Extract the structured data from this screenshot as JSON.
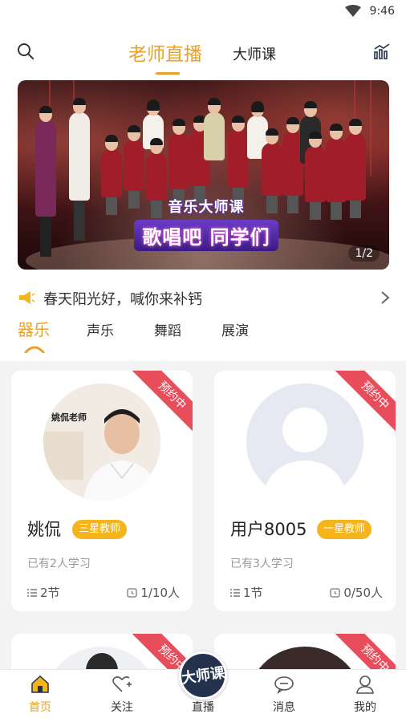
{
  "status_bar": {
    "time": "9:46"
  },
  "header": {
    "tab_live": "老师直播",
    "tab_master": "大师课"
  },
  "banner": {
    "title_line1": "音乐大师课",
    "title_line2": "歌唱吧 同学们",
    "pager": "1/2"
  },
  "notice": {
    "text": "春天阳光好，喊你来补钙"
  },
  "categories": [
    "器乐",
    "声乐",
    "舞蹈",
    "展演"
  ],
  "cards": [
    {
      "ribbon": "预约中",
      "avatar_caption": "姚侃老师",
      "name": "姚侃",
      "badge": "三星教师",
      "learners": "已有2人学习",
      "lessons": "2节",
      "capacity": "1/10人"
    },
    {
      "ribbon": "预约中",
      "name": "用户8005",
      "badge": "一星教师",
      "learners": "已有3人学习",
      "lessons": "1节",
      "capacity": "0/50人"
    },
    {
      "ribbon": "预约中"
    },
    {
      "ribbon": "预约中"
    }
  ],
  "tabbar": {
    "home": "首页",
    "follow": "关注",
    "live": "直播",
    "live_fab": "大师课",
    "messages": "消息",
    "mine": "我的"
  },
  "colors": {
    "accent": "#e8a12a",
    "ribbon": "#e84d5b",
    "badge": "#f5b41c"
  }
}
